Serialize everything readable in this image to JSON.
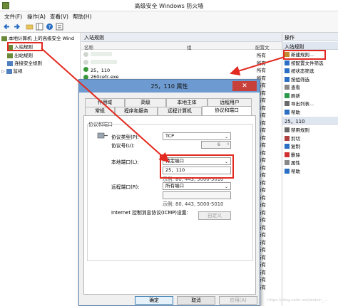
{
  "window": {
    "title": "高级安全 Windows 防火墙"
  },
  "menu": [
    "文件(F)",
    "操作(A)",
    "查看(V)",
    "帮助(H)"
  ],
  "tree": {
    "root": "本地计算机 上的高级安全 Wind",
    "items": [
      "入站规则",
      "出站规则",
      "连接安全规则",
      "监视"
    ]
  },
  "middle": {
    "header": "入站规则",
    "columns": [
      "名称",
      "组",
      "配置文"
    ],
    "rows": [
      {
        "name": "",
        "group": "",
        "profile": "所有"
      },
      {
        "name": "",
        "group": "",
        "profile": "所有"
      },
      {
        "name": "25，110",
        "group": "",
        "profile": "所有"
      },
      {
        "name": "260cefc.exe",
        "group": "",
        "profile": "所有"
      },
      {
        "name": "",
        "group": "",
        "profile": "所有"
      },
      {
        "name": "",
        "group": "",
        "profile": "所有"
      },
      {
        "name": "",
        "group": "",
        "profile": "所有"
      },
      {
        "name": "",
        "group": "",
        "profile": "所有"
      },
      {
        "name": "",
        "group": "",
        "profile": "所有"
      },
      {
        "name": "",
        "group": "",
        "profile": "所有"
      },
      {
        "name": "",
        "group": "",
        "profile": "所有"
      },
      {
        "name": "",
        "group": "",
        "profile": "所有"
      },
      {
        "name": "",
        "group": "",
        "profile": "所有"
      },
      {
        "name": "",
        "group": "",
        "profile": "所有"
      },
      {
        "name": "",
        "group": "",
        "profile": "所有"
      },
      {
        "name": "",
        "group": "",
        "profile": "所有"
      },
      {
        "name": "",
        "group": "",
        "profile": "所有"
      },
      {
        "name": "",
        "group": "",
        "profile": "所有"
      },
      {
        "name": "",
        "group": "",
        "profile": "所有"
      },
      {
        "name": "",
        "group": "",
        "profile": "所有"
      },
      {
        "name": "",
        "group": "",
        "profile": "所有"
      },
      {
        "name": "",
        "group": "",
        "profile": "所有"
      },
      {
        "name": "",
        "group": "",
        "profile": "所有"
      },
      {
        "name": "",
        "group": "",
        "profile": "所有"
      },
      {
        "name": "",
        "group": "",
        "profile": "所有"
      },
      {
        "name": "",
        "group": "",
        "profile": "所有"
      },
      {
        "name": "",
        "group": "",
        "profile": "所有"
      },
      {
        "name": "",
        "group": "",
        "profile": "所有"
      },
      {
        "name": "",
        "group": "",
        "profile": "所有"
      },
      {
        "name": "",
        "group": "",
        "profile": "所有"
      },
      {
        "name": "",
        "group": "",
        "profile": "所有"
      },
      {
        "name": "",
        "group": "",
        "profile": "所有"
      }
    ]
  },
  "actions": {
    "header": "操作",
    "section1": "入站规则",
    "section1_items": [
      "新建规则...",
      "按配置文件筛选",
      "按状态筛选",
      "按组筛选",
      "查看",
      "刷新",
      "导出列表...",
      "帮助"
    ],
    "section2": "25，110",
    "section2_items": [
      "禁用规则",
      "剪切",
      "复制",
      "删除",
      "属性",
      "帮助"
    ]
  },
  "dialog": {
    "title": "25，110 属性",
    "close": "✕",
    "tabs_row1": [
      "作用域",
      "高级",
      "本地主体",
      "远程用户"
    ],
    "tabs_row2": [
      "常规",
      "程序和服务",
      "远程计算机",
      "协议和端口"
    ],
    "group_label": "协议和端口",
    "protocol_type_label": "协议类型(P):",
    "protocol_type_value": "TCP",
    "protocol_number_label": "协议号(U):",
    "protocol_number_value": "6",
    "local_port_label": "本地端口(L):",
    "local_port_select": "特定端口",
    "local_port_value": "25，110",
    "local_port_example": "示例: 80, 443, 5000-5010",
    "remote_port_label": "远程端口(R):",
    "remote_port_select": "所有端口",
    "remote_port_example": "示例: 80, 443, 5000-5010",
    "icmp_label": "Internet 控制消息协议(ICMP)设置:",
    "customize_button": "自定义",
    "ok_button": "确定",
    "cancel_button": "取消",
    "apply_button": "应用(A)",
    "watermark": "https://blog.csdn.net/weixin_..."
  },
  "colors": {
    "annotation": "#e22a20",
    "titlebar": "#6d9ad0",
    "close": "#c7413a"
  }
}
